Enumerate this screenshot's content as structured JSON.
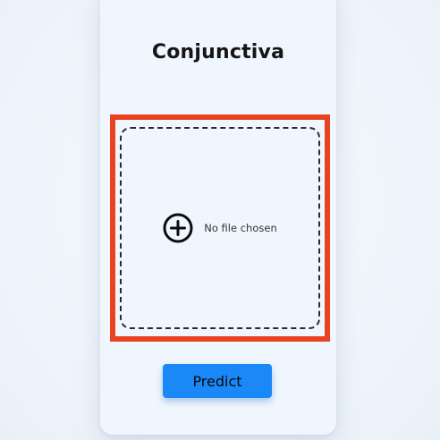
{
  "app": {
    "title": "Conjunctiva"
  },
  "upload": {
    "status_text": "No file chosen",
    "icon": "plus-circle-icon"
  },
  "actions": {
    "predict_label": "Predict"
  },
  "colors": {
    "accent": "#1a88f6",
    "highlight": "#e8421f",
    "card_background": "#f0f6fd"
  }
}
